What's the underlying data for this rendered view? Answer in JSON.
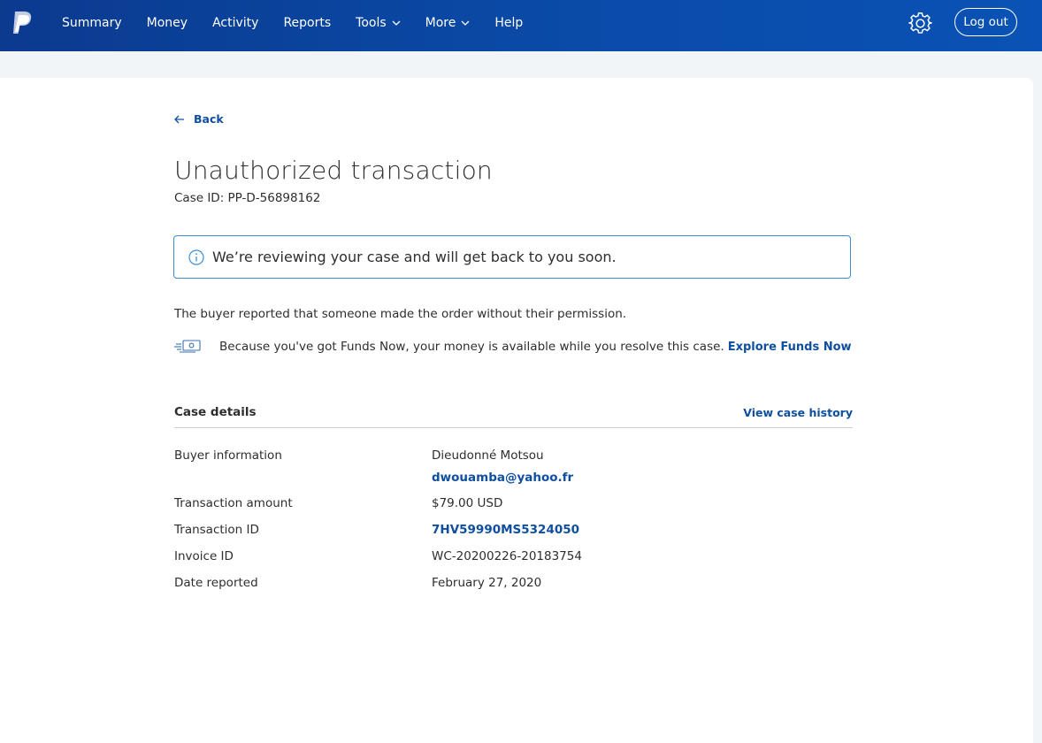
{
  "header": {
    "nav": [
      "Summary",
      "Money",
      "Activity",
      "Reports",
      "Tools",
      "More",
      "Help"
    ],
    "logout_label": "Log out",
    "logo_icon": "paypal-logo",
    "settings_icon": "gear-icon"
  },
  "page": {
    "back_label": "Back",
    "title": "Unauthorized transaction",
    "case_id": "Case ID: PP-D-56898162",
    "alert_text": "We’re reviewing your case and will get back to you soon.",
    "description": "The buyer reported that someone made the order without their permission.",
    "funds_text": "Because you've got Funds Now, your money is available while you resolve this case.",
    "funds_link": "Explore Funds Now"
  },
  "details": {
    "heading": "Case details",
    "history_link": "View case history",
    "buyer_label": "Buyer information",
    "buyer_name": "Dieudonné Motsou",
    "buyer_email": "dwouamba@yahoo.fr",
    "amount_label": "Transaction amount",
    "amount_value": "$79.00 USD",
    "txn_label": "Transaction ID",
    "txn_value": "7HV59990MS5324050",
    "invoice_label": "Invoice ID",
    "invoice_value": "WC-20200226-20183754",
    "date_label": "Date reported",
    "date_value": "February 27, 2020"
  },
  "colors": {
    "header_blue": "#0a4ba8",
    "link_blue": "#0f4fa0",
    "alert_border": "#3a8fd4"
  }
}
